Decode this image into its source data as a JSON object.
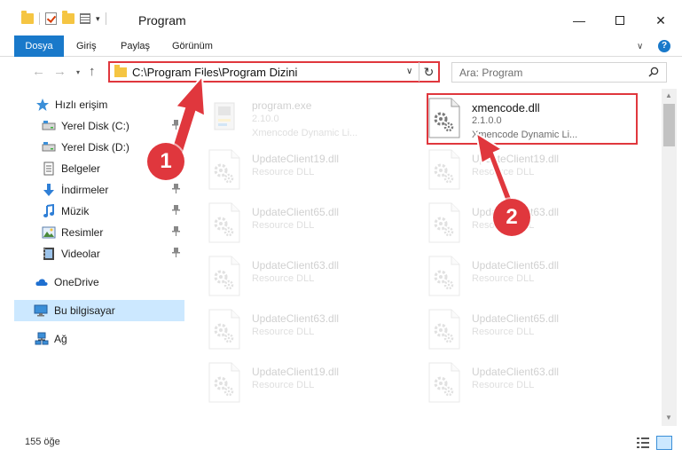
{
  "window": {
    "title": "Program",
    "minimize_glyph": "—",
    "close_glyph": "✕"
  },
  "ribbon": {
    "tabs": [
      "Dosya",
      "Giriş",
      "Paylaş",
      "Görünüm"
    ],
    "expand_glyph": "∨",
    "help_glyph": "?"
  },
  "navigation": {
    "back_glyph": "←",
    "forward_glyph": "→",
    "recent_glyph": "▾",
    "up_glyph": "↑",
    "address_path": "C:\\Program Files\\Program Dizini",
    "address_dropdown_glyph": "∨",
    "refresh_glyph": "↻",
    "search_placeholder": "Ara: Program"
  },
  "sidebar": {
    "items": [
      {
        "label": "Hızlı erişim",
        "icon": "star-icon",
        "pinned": false
      },
      {
        "label": "Yerel Disk (C:)",
        "icon": "drive-icon",
        "pinned": true
      },
      {
        "label": "Yerel Disk (D:)",
        "icon": "drive-icon",
        "pinned": true
      },
      {
        "label": "Belgeler",
        "icon": "document-icon",
        "pinned": true
      },
      {
        "label": "İndirmeler",
        "icon": "download-icon",
        "pinned": true
      },
      {
        "label": "Müzik",
        "icon": "music-icon",
        "pinned": true
      },
      {
        "label": "Resimler",
        "icon": "pictures-icon",
        "pinned": true
      },
      {
        "label": "Videolar",
        "icon": "video-icon",
        "pinned": true
      },
      {
        "label": "OneDrive",
        "icon": "cloud-icon",
        "pinned": false
      },
      {
        "label": "Bu bilgisayar",
        "icon": "computer-icon",
        "pinned": false,
        "selected": true
      },
      {
        "label": "Ağ",
        "icon": "network-icon",
        "pinned": false
      }
    ],
    "pin_glyph": "📌"
  },
  "files": [
    {
      "name": "program.exe",
      "line2": "2.10.0",
      "line3": "Xmencode Dynamic Li...",
      "type": "exe",
      "faded": true
    },
    {
      "name": "xmencode.dll",
      "line2": "2.1.0.0",
      "line3": "Xmencode Dynamic Li...",
      "type": "dll",
      "faded": false,
      "highlighted": true
    },
    {
      "name": "UpdateClient19.dll",
      "line2": "Resource DLL",
      "type": "dll",
      "faded": true
    },
    {
      "name": "UpdateClient19.dll",
      "line2": "Resource DLL",
      "type": "dll",
      "faded": true
    },
    {
      "name": "UpdateClient65.dll",
      "line2": "Resource DLL",
      "type": "dll",
      "faded": true
    },
    {
      "name": "UpdateClient63.dll",
      "line2": "Resource DLL",
      "type": "dll",
      "faded": true
    },
    {
      "name": "UpdateClient63.dll",
      "line2": "Resource DLL",
      "type": "dll",
      "faded": true
    },
    {
      "name": "UpdateClient65.dll",
      "line2": "Resource DLL",
      "type": "dll",
      "faded": true
    },
    {
      "name": "UpdateClient63.dll",
      "line2": "Resource DLL",
      "type": "dll",
      "faded": true
    },
    {
      "name": "UpdateClient65.dll",
      "line2": "Resource DLL",
      "type": "dll",
      "faded": true
    },
    {
      "name": "UpdateClient19.dll",
      "line2": "Resource DLL",
      "type": "dll",
      "faded": true
    },
    {
      "name": "UpdateClient63.dll",
      "line2": "Resource DLL",
      "type": "dll",
      "faded": true
    }
  ],
  "status": {
    "item_count": "155 öğe"
  },
  "callouts": [
    "1",
    "2"
  ],
  "colors": {
    "accent": "#1979ca",
    "highlight": "#e0373d",
    "selected_bg": "#cce8ff",
    "folder": "#f5c542"
  }
}
